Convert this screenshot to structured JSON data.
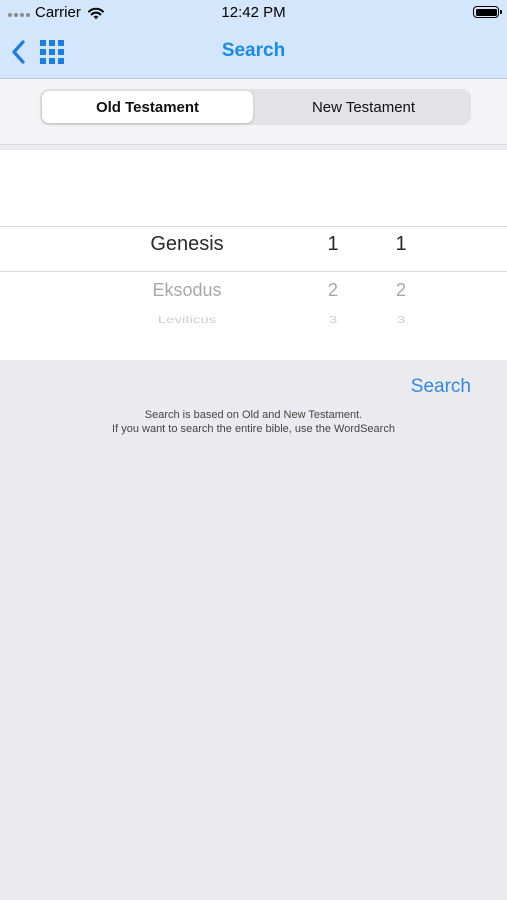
{
  "status_bar": {
    "carrier": "Carrier",
    "time": "12:42 PM"
  },
  "nav": {
    "title": "Search",
    "accent_color": "#1a8ae6"
  },
  "testament_segment": {
    "options": [
      "Old Testament",
      "New Testament"
    ],
    "selected": "Old Testament"
  },
  "picker": {
    "selected": {
      "book": "Genesis",
      "chapter": "1",
      "verse": "1"
    },
    "next": {
      "book": "Eksodus",
      "chapter": "2",
      "verse": "2"
    },
    "next2": {
      "book": "Leviticus",
      "chapter": "3",
      "verse": "3"
    }
  },
  "search_button": "Search",
  "hint": {
    "line1": "Search is based on Old and New Testament.",
    "line2": "If you want to search the entire bible, use the WordSearch"
  }
}
